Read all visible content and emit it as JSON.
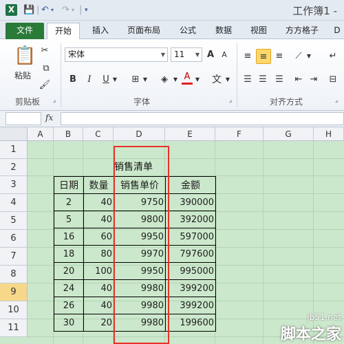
{
  "title_bar": {
    "app_icon_letter": "X",
    "window_title": "工作簿1 -"
  },
  "tabs": [
    {
      "label": "文件"
    },
    {
      "label": "开始"
    },
    {
      "label": "插入"
    },
    {
      "label": "页面布局"
    },
    {
      "label": "公式"
    },
    {
      "label": "数据"
    },
    {
      "label": "视图"
    },
    {
      "label": "方方格子"
    },
    {
      "label": "D"
    }
  ],
  "ribbon": {
    "clipboard": {
      "paste_label": "粘贴",
      "group_label": "剪贴板"
    },
    "font": {
      "font_name": "宋体",
      "font_size": "11",
      "group_label": "字体",
      "bold": "B",
      "italic": "I",
      "underline": "U",
      "grow": "A",
      "shrink": "A",
      "font_color": "A",
      "phonetic": "文"
    },
    "alignment": {
      "group_label": "对齐方式"
    }
  },
  "formula_bar": {
    "fx_label": "fx",
    "cell_ref": "",
    "content": ""
  },
  "grid": {
    "columns": [
      "A",
      "B",
      "C",
      "D",
      "E",
      "F",
      "G",
      "H"
    ],
    "rows": [
      "1",
      "2",
      "3",
      "4",
      "5",
      "6",
      "7",
      "8",
      "9",
      "10",
      "11"
    ],
    "selected_row": "9"
  },
  "sheet": {
    "title": "销售清单",
    "headers": [
      "日期",
      "数量",
      "销售单价",
      "金额"
    ],
    "rows": [
      [
        "2",
        "40",
        "9750",
        "390000"
      ],
      [
        "5",
        "40",
        "9800",
        "392000"
      ],
      [
        "16",
        "60",
        "9950",
        "597000"
      ],
      [
        "18",
        "80",
        "9970",
        "797600"
      ],
      [
        "20",
        "100",
        "9950",
        "995000"
      ],
      [
        "24",
        "40",
        "9980",
        "399200"
      ],
      [
        "26",
        "40",
        "9980",
        "399200"
      ],
      [
        "30",
        "20",
        "9980",
        "199600"
      ]
    ]
  },
  "watermark": {
    "url": "jb51.net",
    "brand": "脚本之家"
  },
  "colors": {
    "grid_bg": "#cce8cc",
    "highlight_box": "#e8312a",
    "file_tab": "#2a7a38",
    "selected_row_header": "#f7d78a"
  }
}
